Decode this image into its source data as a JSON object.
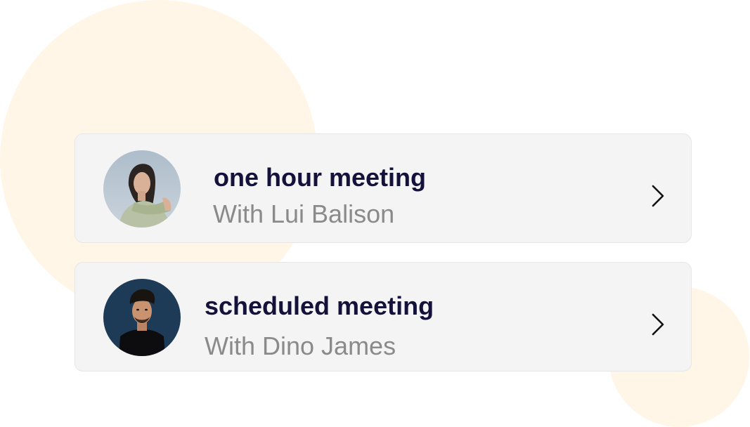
{
  "colors": {
    "background": "#ffffff",
    "decor_blob": "#fff6e7",
    "card_background": "#f4f4f4",
    "title_text": "#14123a",
    "subtitle_text": "#8a8a8a"
  },
  "meetings": [
    {
      "title": "one hour meeting",
      "subtitle": "With Lui Balison",
      "avatar": "avatar-photo-woman",
      "action_icon": "chevron-right-icon"
    },
    {
      "title": "scheduled meeting",
      "subtitle": "With Dino James",
      "avatar": "avatar-photo-man",
      "action_icon": "chevron-right-icon"
    }
  ]
}
